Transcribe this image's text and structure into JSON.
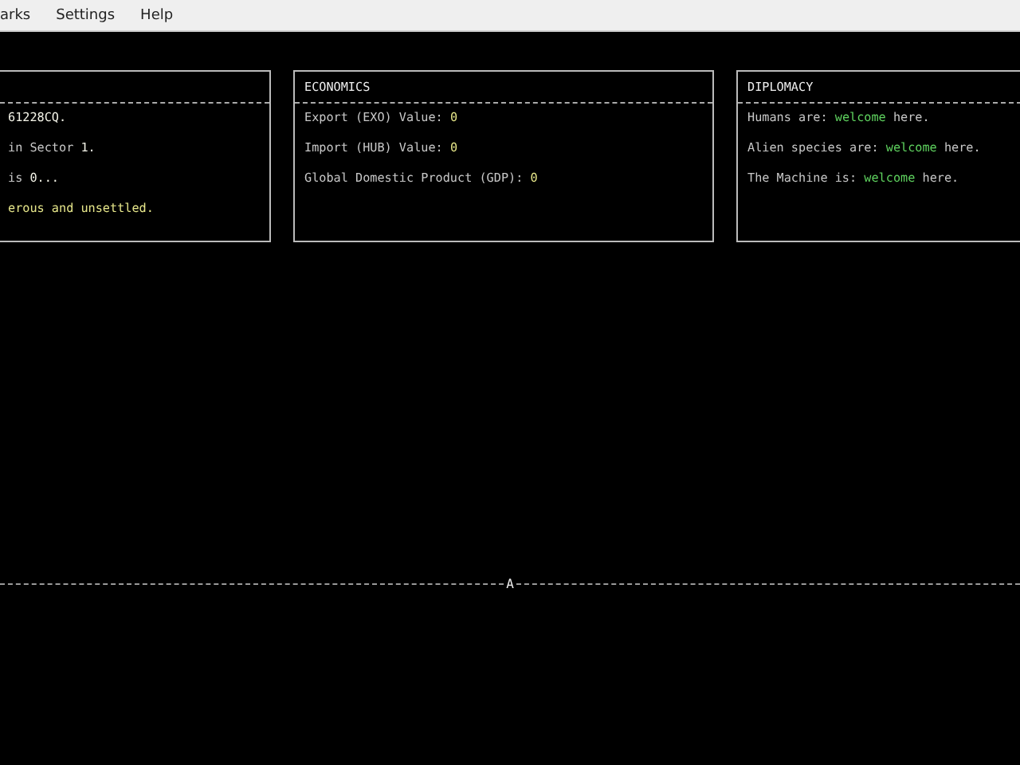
{
  "menu": [
    {
      "label": "arks"
    },
    {
      "label": "Settings"
    },
    {
      "label": "Help"
    }
  ],
  "panels": [
    {
      "lines": [
        [
          {
            "text": "61228CQ.",
            "kind": "bright"
          }
        ],
        [
          {
            "text": "in Sector ",
            "kind": "plain"
          },
          {
            "text": "1.",
            "kind": "bright"
          }
        ],
        [
          {
            "text": "is ",
            "kind": "plain"
          },
          {
            "text": "0...",
            "kind": "bright"
          }
        ],
        [
          {
            "text": "erous and unsettled.",
            "kind": "warn"
          }
        ]
      ]
    },
    {
      "title": "ECONOMICS",
      "lines": [
        [
          {
            "text": "Export (EXO) Value: ",
            "kind": "plain"
          },
          {
            "text": "0",
            "kind": "value"
          }
        ],
        [
          {
            "text": "Import (HUB) Value: ",
            "kind": "plain"
          },
          {
            "text": "0",
            "kind": "value"
          }
        ],
        [
          {
            "text": "Global Domestic Product (GDP): ",
            "kind": "plain"
          },
          {
            "text": "0",
            "kind": "value"
          }
        ]
      ]
    },
    {
      "title": "DIPLOMACY",
      "lines": [
        [
          {
            "text": "Humans are: ",
            "kind": "plain"
          },
          {
            "text": "welcome",
            "kind": "good"
          },
          {
            "text": " here.",
            "kind": "plain"
          }
        ],
        [
          {
            "text": "Alien species are: ",
            "kind": "plain"
          },
          {
            "text": "welcome",
            "kind": "good"
          },
          {
            "text": " here.",
            "kind": "plain"
          }
        ],
        [
          {
            "text": "The Machine is: ",
            "kind": "plain"
          },
          {
            "text": "welcome",
            "kind": "good"
          },
          {
            "text": " here.",
            "kind": "plain"
          }
        ]
      ]
    }
  ],
  "divider": {
    "label": "A"
  }
}
